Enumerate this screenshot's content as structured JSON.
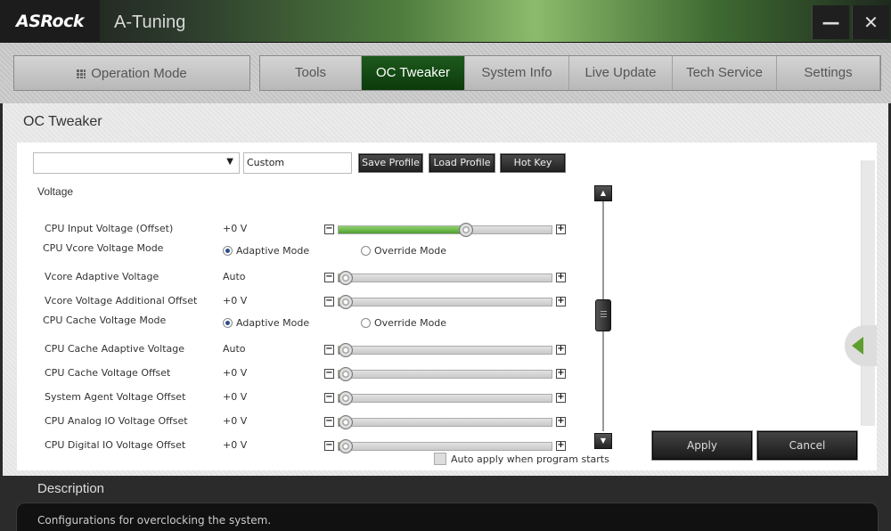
{
  "titlebar": {
    "brand": "ASRock",
    "app_title": "A-Tuning",
    "minimize_glyph": "—",
    "close_glyph": "✕"
  },
  "nav": {
    "operation_mode": "Operation Mode",
    "tabs": [
      {
        "label": "Tools",
        "active": false
      },
      {
        "label": "OC Tweaker",
        "active": true
      },
      {
        "label": "System Info",
        "active": false
      },
      {
        "label": "Live Update",
        "active": false
      },
      {
        "label": "Tech Service",
        "active": false
      },
      {
        "label": "Settings",
        "active": false
      }
    ]
  },
  "page": {
    "title": "OC Tweaker",
    "profile_select_value": "",
    "profile_name": "Custom",
    "save_profile": "Save Profile",
    "load_profile": "Load Profile",
    "hot_key": "Hot Key",
    "section": "Voltage"
  },
  "settings": [
    {
      "label": "CPU Input Voltage (Offset)",
      "value": "+0 V",
      "type": "slider",
      "level": 0.6
    },
    {
      "label": "CPU Vcore Voltage Mode",
      "type": "radio",
      "options": [
        "Adaptive Mode",
        "Override Mode"
      ],
      "selected": "Adaptive Mode"
    },
    {
      "label": "Vcore Adaptive Voltage",
      "value": "Auto",
      "type": "slider",
      "level": 0
    },
    {
      "label": "Vcore Voltage Additional Offset",
      "value": "+0 V",
      "type": "slider",
      "level": 0
    },
    {
      "label": "CPU Cache Voltage Mode",
      "type": "radio",
      "options": [
        "Adaptive Mode",
        "Override Mode"
      ],
      "selected": "Adaptive Mode"
    },
    {
      "label": "CPU Cache Adaptive Voltage",
      "value": "Auto",
      "type": "slider",
      "level": 0
    },
    {
      "label": "CPU Cache Voltage Offset",
      "value": "+0 V",
      "type": "slider",
      "level": 0
    },
    {
      "label": "System Agent Voltage Offset",
      "value": "+0 V",
      "type": "slider",
      "level": 0
    },
    {
      "label": "CPU Analog IO Voltage Offset",
      "value": "+0 V",
      "type": "slider",
      "level": 0
    },
    {
      "label": "CPU Digital IO Voltage Offset",
      "value": "+0 V",
      "type": "slider",
      "level": 0
    }
  ],
  "footer": {
    "auto_apply": "Auto apply when program starts",
    "apply": "Apply",
    "cancel": "Cancel"
  },
  "description": {
    "title": "Description",
    "text": "Configurations for overclocking the system."
  },
  "colors": {
    "active_tab": "#0c3a0c",
    "slider_fill": "#5ea83a",
    "accent_arrow": "#5e9e2e"
  }
}
